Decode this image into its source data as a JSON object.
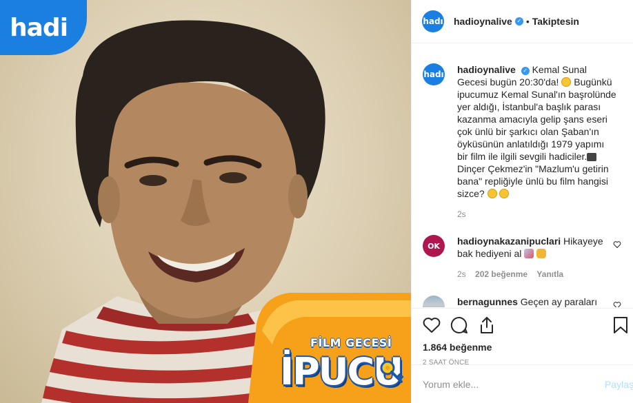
{
  "photo": {
    "logo_text": "hadi",
    "badge_line1": "FİLM GECESİ",
    "badge_line2": "İPUCU"
  },
  "header": {
    "avatar_text": "hadı",
    "username": "hadioynalive",
    "separator": "•",
    "follow_label": "Takiptesin"
  },
  "caption": {
    "avatar_text": "hadı",
    "username": "hadioynalive",
    "text_1": " Kemal Sunal Gecesi bugün 20:30'da! ",
    "text_2": " Bugünkü ipucumuz Kemal Sunal'ın başrolünde yer aldığı, İstanbul'a başlık parası kazanma amacıyla gelip şans eseri çok ünlü bir şarkıcı olan Şaban'ın öyküsünün anlatıldığı 1979 yapımı bir film ile ilgili sevgili hadiciler.",
    "text_3": "Dinçer Çekmez'in \"Mazlum'u getirin bana\" repliğiyle ünlü bu film hangisi sizce? ",
    "time": "2s"
  },
  "comments": [
    {
      "avatar_text": "OK",
      "username": "hadioynakazanipuclari",
      "text": " Hikayeye bak hediyeni al ",
      "time": "2s",
      "likes": "202 beğenme",
      "reply": "Yanıtla"
    },
    {
      "username": "bernagunnes",
      "text": " Geçen ay paraları"
    }
  ],
  "actions": {
    "likes": "1.864 beğenme",
    "time": "2 SAAT ÖNCE",
    "comment_placeholder": "Yorum ekle...",
    "post_label": "Paylaş"
  },
  "colors": {
    "brand": "#1a7fe0",
    "verified": "#3897f0",
    "muted": "#8e8e8e",
    "post_disabled": "#b2dffc"
  }
}
